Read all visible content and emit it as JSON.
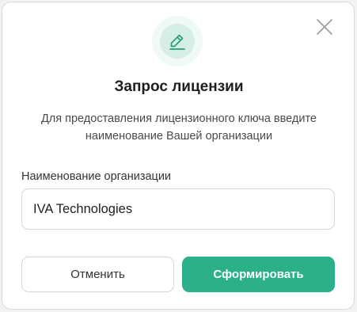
{
  "dialog": {
    "title": "Запрос лицензии",
    "description": "Для предоставления лицензионного ключа введите наименование Вашей организации",
    "header_icon": "pencil-icon",
    "close_icon": "close-icon"
  },
  "form": {
    "org_label": "Наименование организации",
    "org_value": "IVA Technologies"
  },
  "actions": {
    "cancel_label": "Отменить",
    "submit_label": "Сформировать"
  },
  "colors": {
    "accent": "#2bb08a",
    "icon_bg": "#d6efe5",
    "icon_halo": "#f0f9f5"
  }
}
